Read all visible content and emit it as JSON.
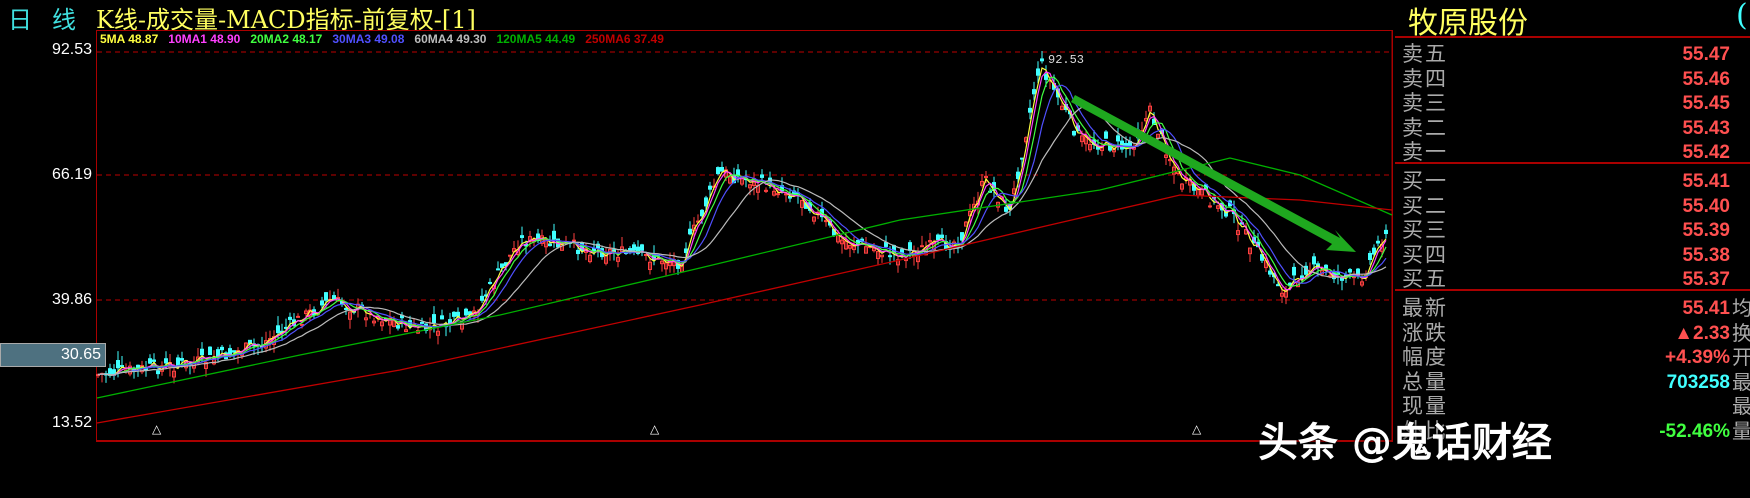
{
  "header": {
    "period_1": "日",
    "period_2": "线",
    "title": "K线-成交量-MACD指标-前复权-[1]",
    "stock_name": "牧原股份",
    "paren": "("
  },
  "legend": [
    {
      "label": "5MA 48.87",
      "color": "#ffff40"
    },
    {
      "label": "10MA1 48.90",
      "color": "#ff40ff"
    },
    {
      "label": "20MA2 48.17",
      "color": "#40ff40"
    },
    {
      "label": "30MA3 49.08",
      "color": "#5050ff"
    },
    {
      "label": "60MA4 49.30",
      "color": "#bbbbbb"
    },
    {
      "label": "120MA5 44.49",
      "color": "#00b000"
    },
    {
      "label": "250MA6 37.49",
      "color": "#c00000"
    }
  ],
  "axis": {
    "ticks": [
      "92.53",
      "66.19",
      "39.86",
      "13.52"
    ],
    "cursor_value": "30.65"
  },
  "chart": {
    "peak_label": "92.53",
    "type": "candlestick"
  },
  "order_book": {
    "asks": [
      {
        "label": "卖五",
        "price": "55.47"
      },
      {
        "label": "卖四",
        "price": "55.46"
      },
      {
        "label": "卖三",
        "price": "55.45"
      },
      {
        "label": "卖二",
        "price": "55.43"
      },
      {
        "label": "卖一",
        "price": "55.42"
      }
    ],
    "bids": [
      {
        "label": "买一",
        "price": "55.41"
      },
      {
        "label": "买二",
        "price": "55.40"
      },
      {
        "label": "买三",
        "price": "55.39"
      },
      {
        "label": "买四",
        "price": "55.38"
      },
      {
        "label": "买五",
        "price": "55.37"
      }
    ]
  },
  "quote": [
    {
      "label": "最新",
      "value": "55.41",
      "color": "#ff5050",
      "extra": "均"
    },
    {
      "label": "涨跌",
      "value": "▲2.33",
      "color": "#ff5050",
      "extra": "换"
    },
    {
      "label": "幅度",
      "value": "+4.39%",
      "color": "#ff5050",
      "extra": "开"
    },
    {
      "label": "总量",
      "value": "703258",
      "color": "#40ffff",
      "extra": "最"
    },
    {
      "label": "现量",
      "value": "",
      "color": "#ffff40",
      "extra": "最"
    },
    {
      "label": "外比",
      "value": "-52.46%",
      "color": "#40ff40",
      "extra": "量"
    }
  ],
  "watermark": "头条 @鬼话财经",
  "colors": {
    "up": "#ff4040",
    "down": "#40ffff",
    "frame": "#aa0000",
    "arrow": "#1fa81f"
  }
}
